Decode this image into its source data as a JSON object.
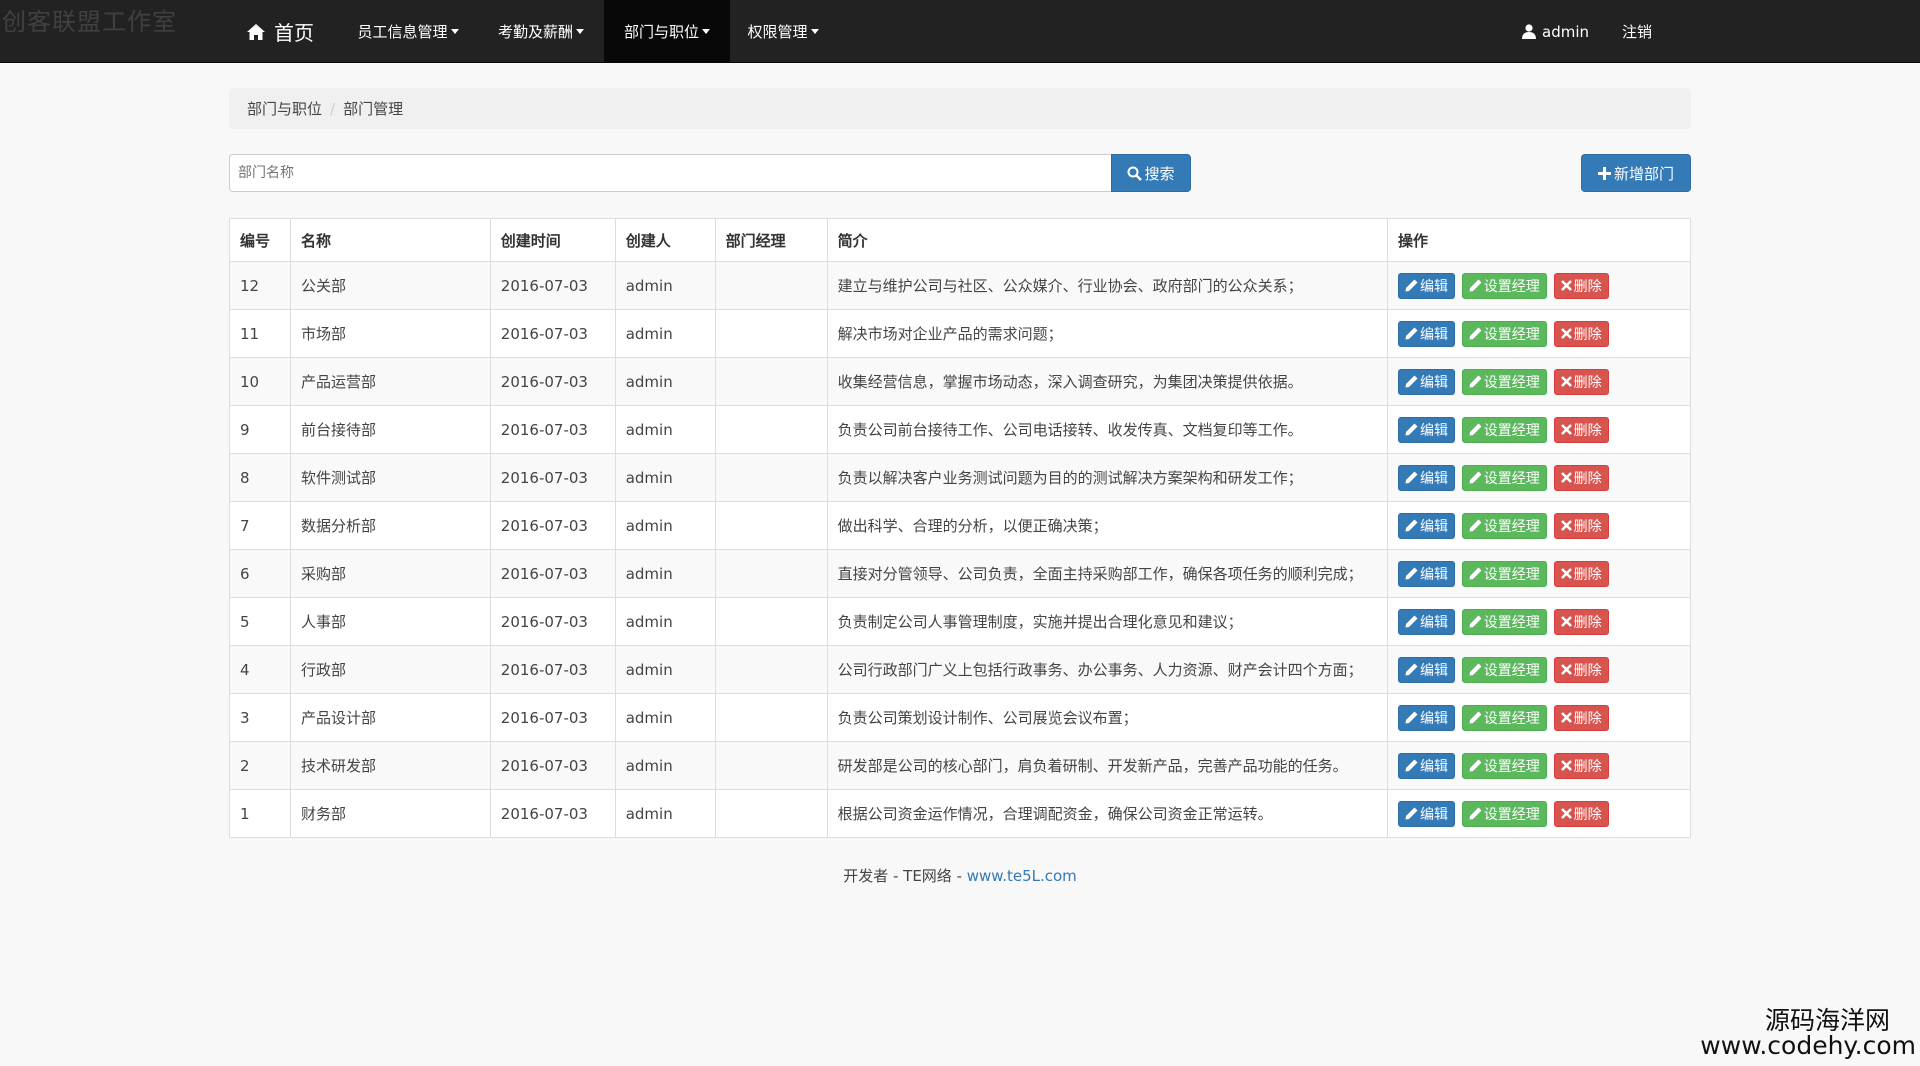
{
  "watermark_top": "创客联盟工作室",
  "nav": {
    "home": "首页",
    "items": [
      {
        "label": "员工信息管理"
      },
      {
        "label": "考勤及薪酬"
      },
      {
        "label": "部门与职位"
      },
      {
        "label": "权限管理"
      }
    ],
    "user": "admin",
    "logout": "注销"
  },
  "breadcrumb": {
    "parent": "部门与职位",
    "current": "部门管理"
  },
  "search": {
    "placeholder": "部门名称",
    "button": "搜索"
  },
  "add_button": "新增部门",
  "table": {
    "headers": [
      "编号",
      "名称",
      "创建时间",
      "创建人",
      "部门经理",
      "简介",
      "操作"
    ],
    "rows": [
      {
        "id": "12",
        "name": "公关部",
        "created": "2016-07-03",
        "creator": "admin",
        "manager": "",
        "desc": "建立与维护公司与社区、公众媒介、行业协会、政府部门的公众关系；"
      },
      {
        "id": "11",
        "name": "市场部",
        "created": "2016-07-03",
        "creator": "admin",
        "manager": "",
        "desc": "解决市场对企业产品的需求问题；"
      },
      {
        "id": "10",
        "name": "产品运营部",
        "created": "2016-07-03",
        "creator": "admin",
        "manager": "",
        "desc": "收集经营信息，掌握市场动态，深入调查研究，为集团决策提供依据。"
      },
      {
        "id": "9",
        "name": "前台接待部",
        "created": "2016-07-03",
        "creator": "admin",
        "manager": "",
        "desc": "负责公司前台接待工作、公司电话接转、收发传真、文档复印等工作。"
      },
      {
        "id": "8",
        "name": "软件测试部",
        "created": "2016-07-03",
        "creator": "admin",
        "manager": "",
        "desc": "负责以解决客户业务测试问题为目的的测试解决方案架构和研发工作；"
      },
      {
        "id": "7",
        "name": "数据分析部",
        "created": "2016-07-03",
        "creator": "admin",
        "manager": "",
        "desc": "做出科学、合理的分析，以便正确决策；"
      },
      {
        "id": "6",
        "name": "采购部",
        "created": "2016-07-03",
        "creator": "admin",
        "manager": "",
        "desc": "直接对分管领导、公司负责，全面主持采购部工作，确保各项任务的顺利完成；"
      },
      {
        "id": "5",
        "name": "人事部",
        "created": "2016-07-03",
        "creator": "admin",
        "manager": "",
        "desc": "负责制定公司人事管理制度，实施并提出合理化意见和建议；"
      },
      {
        "id": "4",
        "name": "行政部",
        "created": "2016-07-03",
        "creator": "admin",
        "manager": "",
        "desc": "公司行政部门广义上包括行政事务、办公事务、人力资源、财产会计四个方面；"
      },
      {
        "id": "3",
        "name": "产品设计部",
        "created": "2016-07-03",
        "creator": "admin",
        "manager": "",
        "desc": "负责公司策划设计制作、公司展览会议布置；"
      },
      {
        "id": "2",
        "name": "技术研发部",
        "created": "2016-07-03",
        "creator": "admin",
        "manager": "",
        "desc": "研发部是公司的核心部门，肩负着研制、开发新产品，完善产品功能的任务。"
      },
      {
        "id": "1",
        "name": "财务部",
        "created": "2016-07-03",
        "creator": "admin",
        "manager": "",
        "desc": "根据公司资金运作情况，合理调配资金，确保公司资金正常运转。"
      }
    ],
    "actions": {
      "edit": "编辑",
      "set_manager": "设置经理",
      "delete": "删除"
    }
  },
  "footer": {
    "text": "开发者 - TE网络 - ",
    "link": "www.te5L.com"
  },
  "watermark_bottom": {
    "cn": "源码海洋网",
    "en": "www.codehy.com"
  },
  "colors": {
    "navbar": "#222222",
    "primary": "#337ab7",
    "success": "#5cb85c",
    "danger": "#d9534f"
  }
}
